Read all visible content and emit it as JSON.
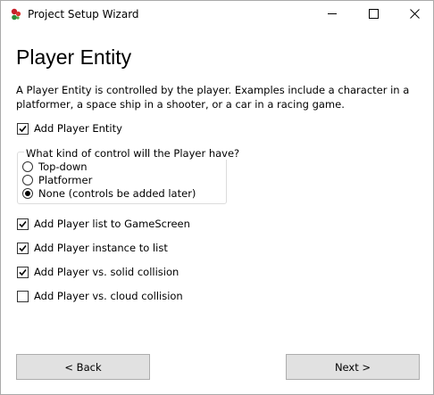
{
  "window": {
    "title": "Project Setup Wizard",
    "icon": "app-logo-icon",
    "controls": [
      "minimize-icon",
      "maximize-icon",
      "close-icon"
    ]
  },
  "page": {
    "title": "Player Entity",
    "description": "A Player Entity is controlled by the player. Examples include a character in a platformer, a space ship in a shooter, or a car in a racing game."
  },
  "add_player": {
    "label": "Add Player Entity",
    "checked": true
  },
  "control_group": {
    "title": "What kind of control will the Player have?",
    "options": [
      {
        "label": "Top-down",
        "selected": false
      },
      {
        "label": "Platformer",
        "selected": false
      },
      {
        "label": "None (controls be added later)",
        "selected": true
      }
    ]
  },
  "options": [
    {
      "label": "Add Player list to GameScreen",
      "checked": true
    },
    {
      "label": "Add Player instance to list",
      "checked": true
    },
    {
      "label": "Add Player vs. solid collision",
      "checked": true
    },
    {
      "label": "Add Player vs. cloud collision",
      "checked": false
    }
  ],
  "buttons": {
    "back": "< Back",
    "next": "Next >"
  }
}
